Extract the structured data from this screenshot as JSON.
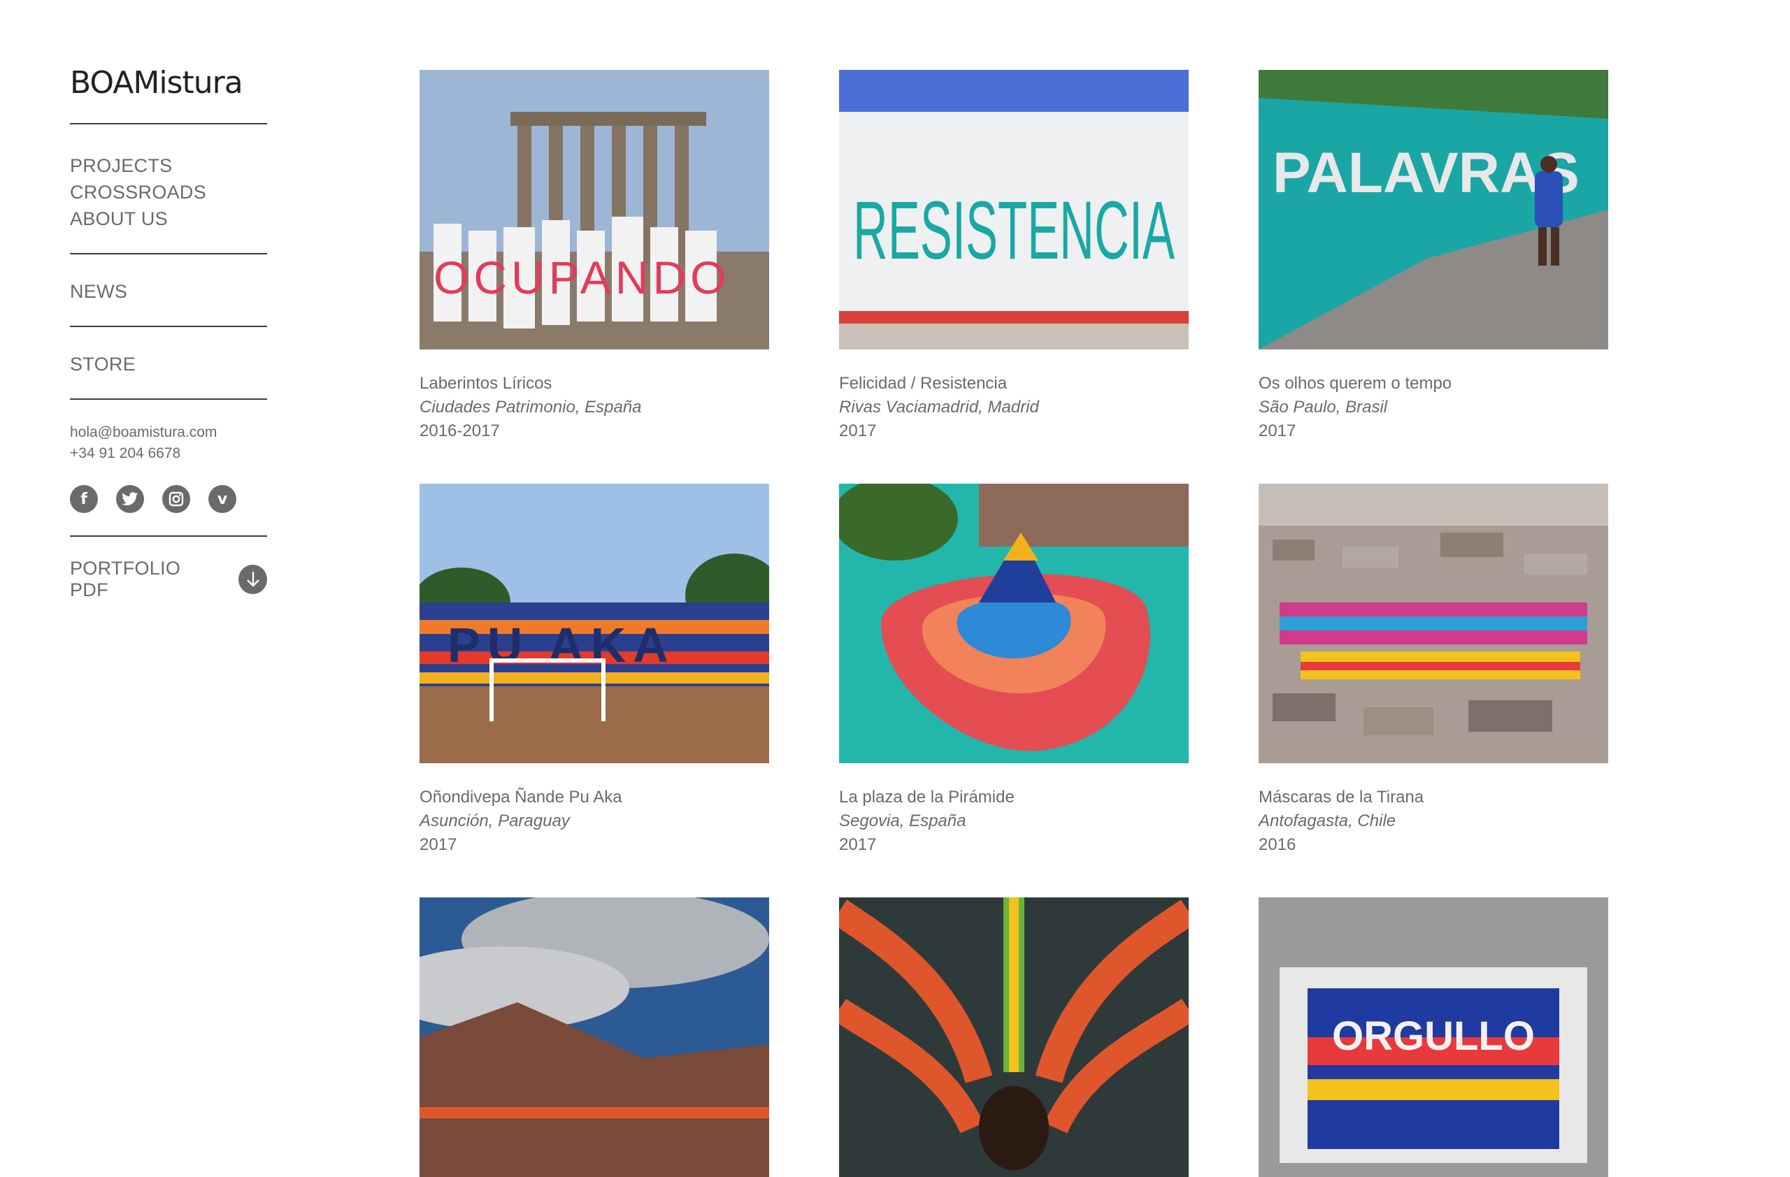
{
  "brand": {
    "logo_text": "BOAMistura"
  },
  "nav": {
    "main": [
      "PROJECTS",
      "CROSSROADS",
      "ABOUT US"
    ],
    "news": "NEWS",
    "store": "STORE"
  },
  "contact": {
    "email": "hola@boamistura.com",
    "phone": "+34 91 204 6678"
  },
  "socials": [
    {
      "icon": "facebook-icon",
      "glyph": "f"
    },
    {
      "icon": "twitter-icon",
      "glyph": "t"
    },
    {
      "icon": "instagram-icon",
      "glyph": "◎"
    },
    {
      "icon": "vimeo-icon",
      "glyph": "v"
    }
  ],
  "portfolio": {
    "label": "PORTFOLIO PDF",
    "icon": "download-arrow-icon"
  },
  "projects": [
    {
      "title": "Laberintos Líricos",
      "place": "Ciudades Patrimonio, España",
      "year": "2016-2017",
      "image_text": "OCUPANDO",
      "colors": [
        "#9db6d6",
        "#8a7a6a",
        "#e23b5b"
      ]
    },
    {
      "title": "Felicidad / Resistencia",
      "place": "Rivas Vaciamadrid, Madrid",
      "year": "2017",
      "image_text": "RESISTENCIA",
      "colors": [
        "#4a6fd6",
        "#eef0f2",
        "#1aa8a4"
      ]
    },
    {
      "title": "Os olhos querem o tempo",
      "place": "São Paulo, Brasil",
      "year": "2017",
      "image_text": "PALAVRAS",
      "colors": [
        "#3f7a3a",
        "#1aa6a4",
        "#8d8a88"
      ]
    },
    {
      "title": "Oñondivepa Ñande Pu Aka",
      "place": "Asunción, Paraguay",
      "year": "2017",
      "image_text": "PU AKA",
      "colors": [
        "#9fc0e6",
        "#2b3f8f",
        "#9b6b4a"
      ]
    },
    {
      "title": "La plaza de la Pirámide",
      "place": "Segovia, España",
      "year": "2017",
      "image_text": "",
      "colors": [
        "#22b7aa",
        "#e44d52",
        "#2c8ad6"
      ]
    },
    {
      "title": "Máscaras de la Tirana",
      "place": "Antofagasta, Chile",
      "year": "2016",
      "image_text": "",
      "colors": [
        "#a89c94",
        "#d23a8c",
        "#2d9fd6"
      ]
    },
    {
      "title": "",
      "place": "",
      "year": "",
      "image_text": "",
      "colors": [
        "#2c5a94",
        "#b0b3b8",
        "#7a4a3a"
      ]
    },
    {
      "title": "",
      "place": "",
      "year": "",
      "image_text": "",
      "colors": [
        "#e0562c",
        "#2e3a3a",
        "#f3c21c"
      ]
    },
    {
      "title": "",
      "place": "",
      "year": "",
      "image_text": "ORGULLO",
      "colors": [
        "#9a9a9a",
        "#1f3aa0",
        "#e83a3a"
      ]
    }
  ]
}
